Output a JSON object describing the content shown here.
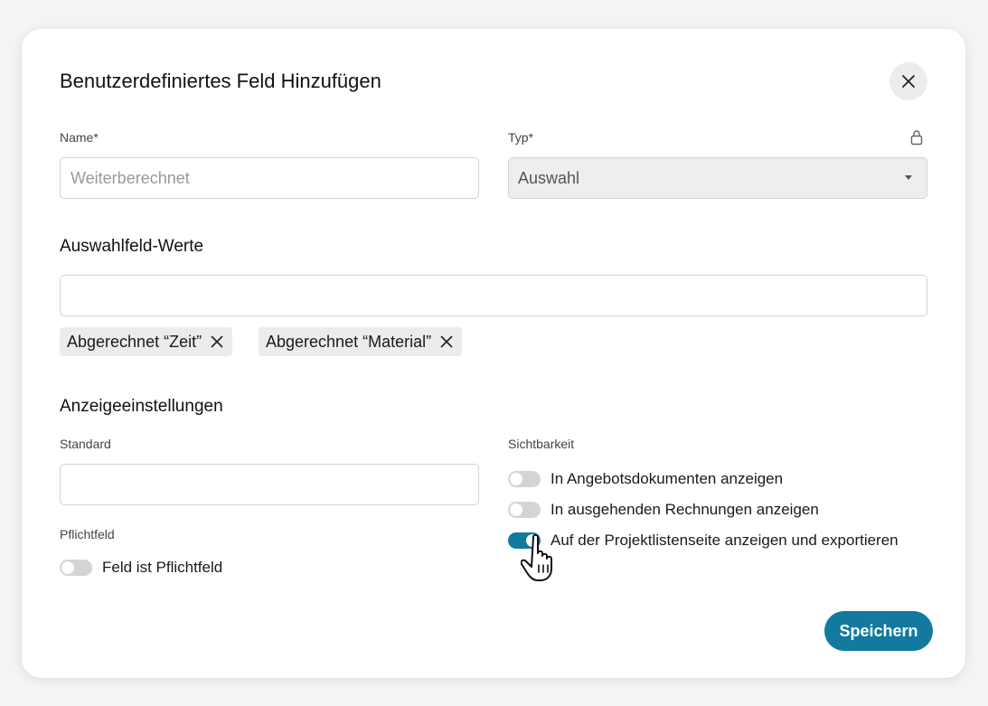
{
  "dialog": {
    "title": "Benutzerdefiniertes Feld Hinzufügen",
    "close_icon": "close-icon"
  },
  "name_field": {
    "label": "Name*",
    "placeholder": "Weiterberechnet",
    "value": ""
  },
  "type_field": {
    "label": "Typ*",
    "value": "Auswahl",
    "lock_icon": "lock-icon"
  },
  "options_section": {
    "title": "Auswahlfeld-Werte",
    "input_value": "",
    "chips": [
      {
        "label": "Abgerechnet “Zeit”"
      },
      {
        "label": "Abgerechnet “Material”"
      }
    ]
  },
  "display_section": {
    "title": "Anzeigeeinstellungen",
    "default_label": "Standard",
    "default_value": "",
    "required_label": "Pflichtfeld",
    "required_toggle": {
      "label": "Feld ist Pflichtfeld",
      "on": false
    },
    "visibility_label": "Sichtbarkeit",
    "visibility_toggles": [
      {
        "label": "In Angebotsdokumenten anzeigen",
        "on": false
      },
      {
        "label": "In ausgehenden Rechnungen anzeigen",
        "on": false
      },
      {
        "label": "Auf der Projektlistenseite anzeigen und exportieren",
        "on": true
      }
    ]
  },
  "save_label": "Speichern",
  "colors": {
    "accent": "#117a9e",
    "toggle_off": "#d4d4d4",
    "chip_bg": "#ececec"
  }
}
